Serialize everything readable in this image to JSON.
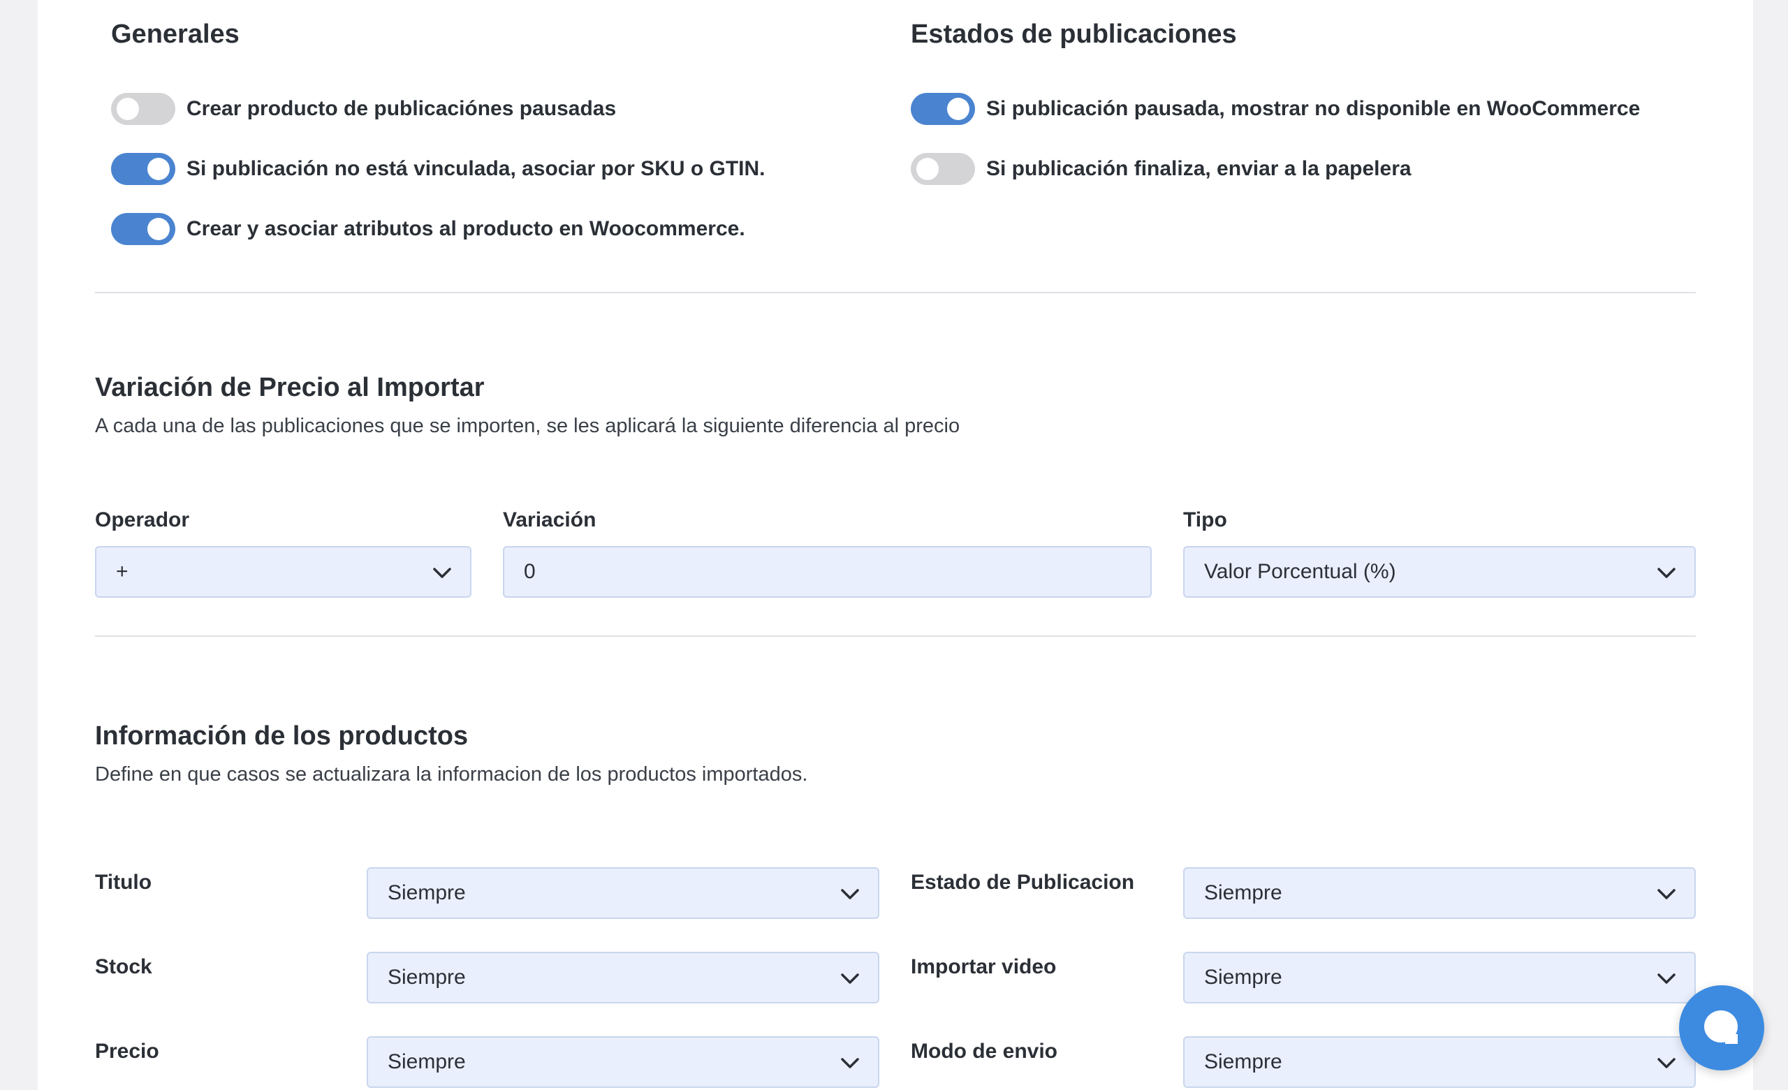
{
  "generales": {
    "title": "Generales",
    "toggles": [
      {
        "label": "Crear producto de publicaciónes pausadas",
        "on": false
      },
      {
        "label": "Si publicación no está vinculada, asociar por SKU o GTIN.",
        "on": true
      },
      {
        "label": "Crear y asociar atributos al producto en Woocommerce.",
        "on": true
      }
    ]
  },
  "estados": {
    "title": "Estados de publicaciones",
    "toggles": [
      {
        "label": "Si publicación pausada, mostrar no disponible en WooCommerce",
        "on": true
      },
      {
        "label": "Si publicación finaliza, enviar a la papelera",
        "on": false
      }
    ]
  },
  "variacion": {
    "title": "Variación de Precio al Importar",
    "description": "A cada una de las publicaciones que se importen, se les aplicará la siguiente diferencia al precio",
    "operador": {
      "label": "Operador",
      "value": "+"
    },
    "variacion": {
      "label": "Variación",
      "value": "0"
    },
    "tipo": {
      "label": "Tipo",
      "value": "Valor Porcentual (%)"
    }
  },
  "info": {
    "title": "Información de los productos",
    "description": "Define en que casos se actualizara la informacion de los productos importados.",
    "fields": [
      {
        "label": "Titulo",
        "value": "Siempre"
      },
      {
        "label": "Estado de Publicacion",
        "value": "Siempre"
      },
      {
        "label": "Stock",
        "value": "Siempre"
      },
      {
        "label": "Importar video",
        "value": "Siempre"
      },
      {
        "label": "Precio",
        "value": "Siempre"
      },
      {
        "label": "Modo de envio",
        "value": "Siempre"
      }
    ]
  },
  "chat": {
    "icon": "chat-bubble-icon",
    "color": "#3d8be0"
  },
  "colors": {
    "toggle_on": "#4a84d0",
    "toggle_off": "#d4d4d6",
    "field_bg": "#e9effc"
  }
}
